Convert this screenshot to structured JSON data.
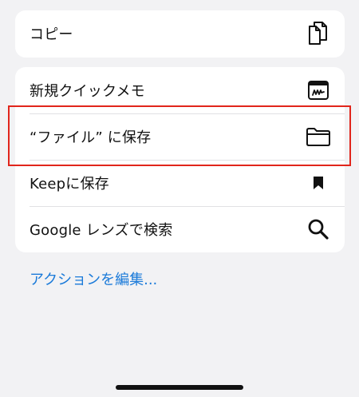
{
  "menu": {
    "copy": {
      "label": "コピー",
      "icon": "copy-icon"
    },
    "items": [
      {
        "label": "新規クイックメモ",
        "icon": "quick-note-icon"
      },
      {
        "label": "“ファイル” に保存",
        "icon": "folder-icon"
      },
      {
        "label": "Keepに保存",
        "icon": "bookmark-icon"
      },
      {
        "label": "Google レンズで検索",
        "icon": "search-icon"
      }
    ],
    "edit_actions_label": "アクションを編集..."
  },
  "colors": {
    "highlight": "#e1251b",
    "link": "#1a7ad9",
    "background": "#f2f2f4",
    "card": "#ffffff"
  }
}
